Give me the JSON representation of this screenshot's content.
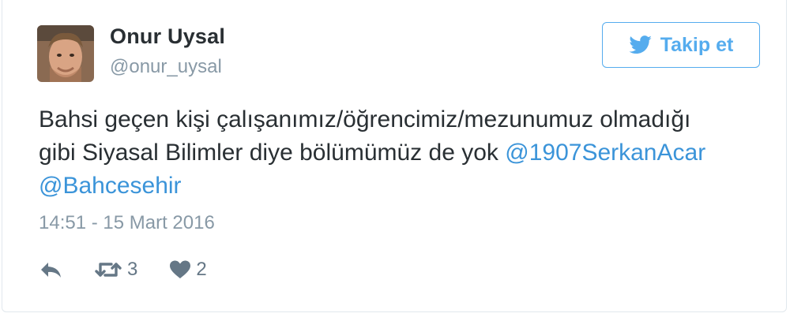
{
  "user": {
    "display_name": "Onur Uysal",
    "handle": "@onur_uysal"
  },
  "follow_button": {
    "label": "Takip et",
    "icon": "twitter-bird-icon"
  },
  "tweet": {
    "line1": "Bahsi geçen kişi çalışanımız/öğrencimiz/mezunumuz olmadığı",
    "line2_text": "gibi Siyasal Bilimler diye bölümümüz de yok ",
    "mention1": "@1907SerkanAcar",
    "mention2": "@Bahcesehir",
    "timestamp": "14:51 - 15 Mart 2016"
  },
  "actions": {
    "reply": {
      "icon": "reply-icon"
    },
    "retweet": {
      "icon": "retweet-icon",
      "count": "3"
    },
    "like": {
      "icon": "heart-icon",
      "count": "2"
    }
  },
  "colors": {
    "accent": "#55acee",
    "link": "#3b94d9",
    "text": "#292f33",
    "muted": "#8899a6",
    "action_icon": "#657786",
    "border": "#e1e8ed"
  }
}
